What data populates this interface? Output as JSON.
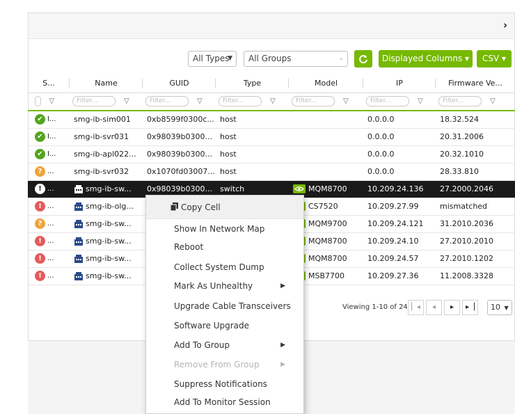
{
  "header": {
    "expand_icon": "chevron-right-icon"
  },
  "toolbar": {
    "types_select": "All Types",
    "groups_select": "All Groups",
    "refresh_icon": "refresh-icon",
    "displayed_columns": "Displayed Columns ▾",
    "csv": "CSV ▾"
  },
  "columns": [
    "S...",
    "Name",
    "GUID",
    "Type",
    "Model",
    "IP",
    "Firmware Ve..."
  ],
  "filter_placeholder": "Filter...",
  "rows": [
    {
      "status": "ok",
      "status_text": "I...",
      "name": "smg-ib-sim001",
      "guid": "0xb8599f0300c...",
      "type": "host",
      "model": "",
      "ip": "0.0.0.0",
      "firmware": "18.32.524"
    },
    {
      "status": "ok",
      "status_text": "I...",
      "name": "smg-ib-svr031",
      "guid": "0x98039b0300...",
      "type": "host",
      "model": "",
      "ip": "0.0.0.0",
      "firmware": "20.31.2006"
    },
    {
      "status": "ok",
      "status_text": "I...",
      "name": "smg-ib-apl022...",
      "guid": "0x98039b0300...",
      "type": "host",
      "model": "",
      "ip": "0.0.0.0",
      "firmware": "20.32.1010"
    },
    {
      "status": "warn",
      "status_text": "...",
      "name": "smg-ib-svr032",
      "guid": "0x1070fd03007...",
      "type": "host",
      "model": "",
      "ip": "0.0.0.0",
      "firmware": "28.33.810"
    },
    {
      "status": "crit",
      "status_text": "...",
      "name": "smg-ib-sw...",
      "guid": "0x98039b0300...",
      "type": "switch",
      "model": "MQM8700",
      "ip": "10.209.24.136",
      "firmware": "27.2000.2046"
    },
    {
      "status": "err",
      "status_text": "...",
      "name": "smg-ib-olg...",
      "guid": "",
      "type": "",
      "model": "CS7520",
      "ip": "10.209.27.99",
      "firmware": "mismatched"
    },
    {
      "status": "warn",
      "status_text": "...",
      "name": "smg-ib-sw...",
      "guid": "",
      "type": "",
      "model": "MQM9700",
      "ip": "10.209.24.121",
      "firmware": "31.2010.2036"
    },
    {
      "status": "err",
      "status_text": "...",
      "name": "smg-ib-sw...",
      "guid": "",
      "type": "",
      "model": "MQM8700",
      "ip": "10.209.24.10",
      "firmware": "27.2010.2010"
    },
    {
      "status": "err",
      "status_text": "...",
      "name": "smg-ib-sw...",
      "guid": "",
      "type": "",
      "model": "MQM8700",
      "ip": "10.209.24.57",
      "firmware": "27.2010.1202"
    },
    {
      "status": "err",
      "status_text": "...",
      "name": "smg-ib-sw...",
      "guid": "",
      "type": "",
      "model": "MSB7700",
      "ip": "10.209.27.36",
      "firmware": "11.2008.3328"
    }
  ],
  "pager": {
    "viewing": "Viewing 1-10 of 24",
    "first": "▏◂",
    "prev": "◂",
    "next": "▸",
    "last": "▸▕",
    "page_size": "10"
  },
  "context_menu": {
    "items": [
      {
        "label": "Copy Cell",
        "icon": "copy-icon",
        "disabled": false,
        "submenu": false
      },
      {
        "label": "Show In Network Map",
        "disabled": false,
        "submenu": false
      },
      {
        "label": "Reboot",
        "disabled": false,
        "submenu": false
      },
      {
        "label": "Collect System Dump",
        "disabled": false,
        "submenu": false
      },
      {
        "label": "Mark As Unhealthy",
        "disabled": false,
        "submenu": true
      },
      {
        "label": "Upgrade Cable Transceivers",
        "disabled": false,
        "submenu": false
      },
      {
        "label": "Software Upgrade",
        "disabled": false,
        "submenu": false
      },
      {
        "label": "Add To Group",
        "disabled": false,
        "submenu": true
      },
      {
        "label": "Remove From Group",
        "disabled": true,
        "submenu": true
      },
      {
        "label": "Suppress Notifications",
        "disabled": false,
        "submenu": false
      },
      {
        "label": "Add To Monitor Session",
        "disabled": false,
        "submenu": false
      }
    ]
  },
  "colors": {
    "accent": "#76b900",
    "ok": "#52a41c",
    "warn": "#f0a33a",
    "err": "#e45a5a",
    "selected_row": "#1a1a1a"
  }
}
